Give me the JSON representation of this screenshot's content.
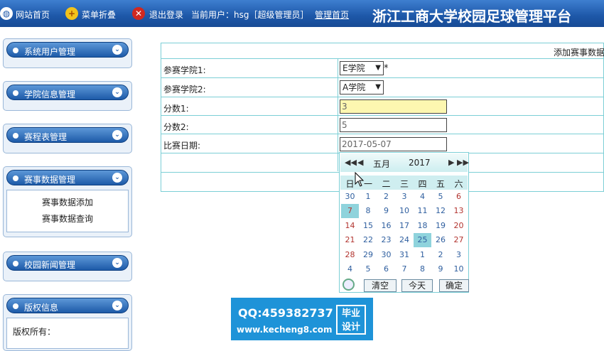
{
  "topbar": {
    "home": "网站首页",
    "menu_toggle": "菜单折叠",
    "logout": "退出登录",
    "current_user": "当前用户：hsg［超级管理员］",
    "admin_home": "管理首页",
    "title": "浙江工商大学校园足球管理平台"
  },
  "sidebar": {
    "sections": [
      {
        "label": "系统用户管理"
      },
      {
        "label": "学院信息管理"
      },
      {
        "label": "赛程表管理"
      },
      {
        "label": "赛事数据管理",
        "items": [
          "赛事数据添加",
          "赛事数据查询"
        ]
      },
      {
        "label": "校园新闻管理"
      },
      {
        "label": "版权信息",
        "items": [
          "版权所有："
        ]
      }
    ]
  },
  "form": {
    "add_link": "添加赛事数据",
    "rows": [
      {
        "label": "参赛学院1:",
        "value": "E学院",
        "required": "*"
      },
      {
        "label": "参赛学院2:",
        "value": "A学院"
      },
      {
        "label": "分数1:",
        "value": "3"
      },
      {
        "label": "分数2:",
        "value": "5"
      },
      {
        "label": "比赛日期:",
        "value": "2017-05-07"
      }
    ]
  },
  "calendar": {
    "month": "五月",
    "year": "2017",
    "weekdays": [
      "日",
      "一",
      "二",
      "三",
      "四",
      "五",
      "六"
    ],
    "weeks": [
      [
        "30",
        "1",
        "2",
        "3",
        "4",
        "5",
        "6"
      ],
      [
        "7",
        "8",
        "9",
        "10",
        "11",
        "12",
        "13"
      ],
      [
        "14",
        "15",
        "16",
        "17",
        "18",
        "19",
        "20"
      ],
      [
        "21",
        "22",
        "23",
        "24",
        "25",
        "26",
        "27"
      ],
      [
        "28",
        "29",
        "30",
        "31",
        "1",
        "2",
        "3"
      ],
      [
        "4",
        "5",
        "6",
        "7",
        "8",
        "9",
        "10"
      ]
    ],
    "selected_day": "7",
    "today": "25",
    "buttons": {
      "clear": "清空",
      "today": "今天",
      "ok": "确定"
    }
  },
  "watermark": {
    "qq": "QQ:459382737",
    "url": "www.kecheng8.com",
    "badge": "毕业 设计"
  }
}
